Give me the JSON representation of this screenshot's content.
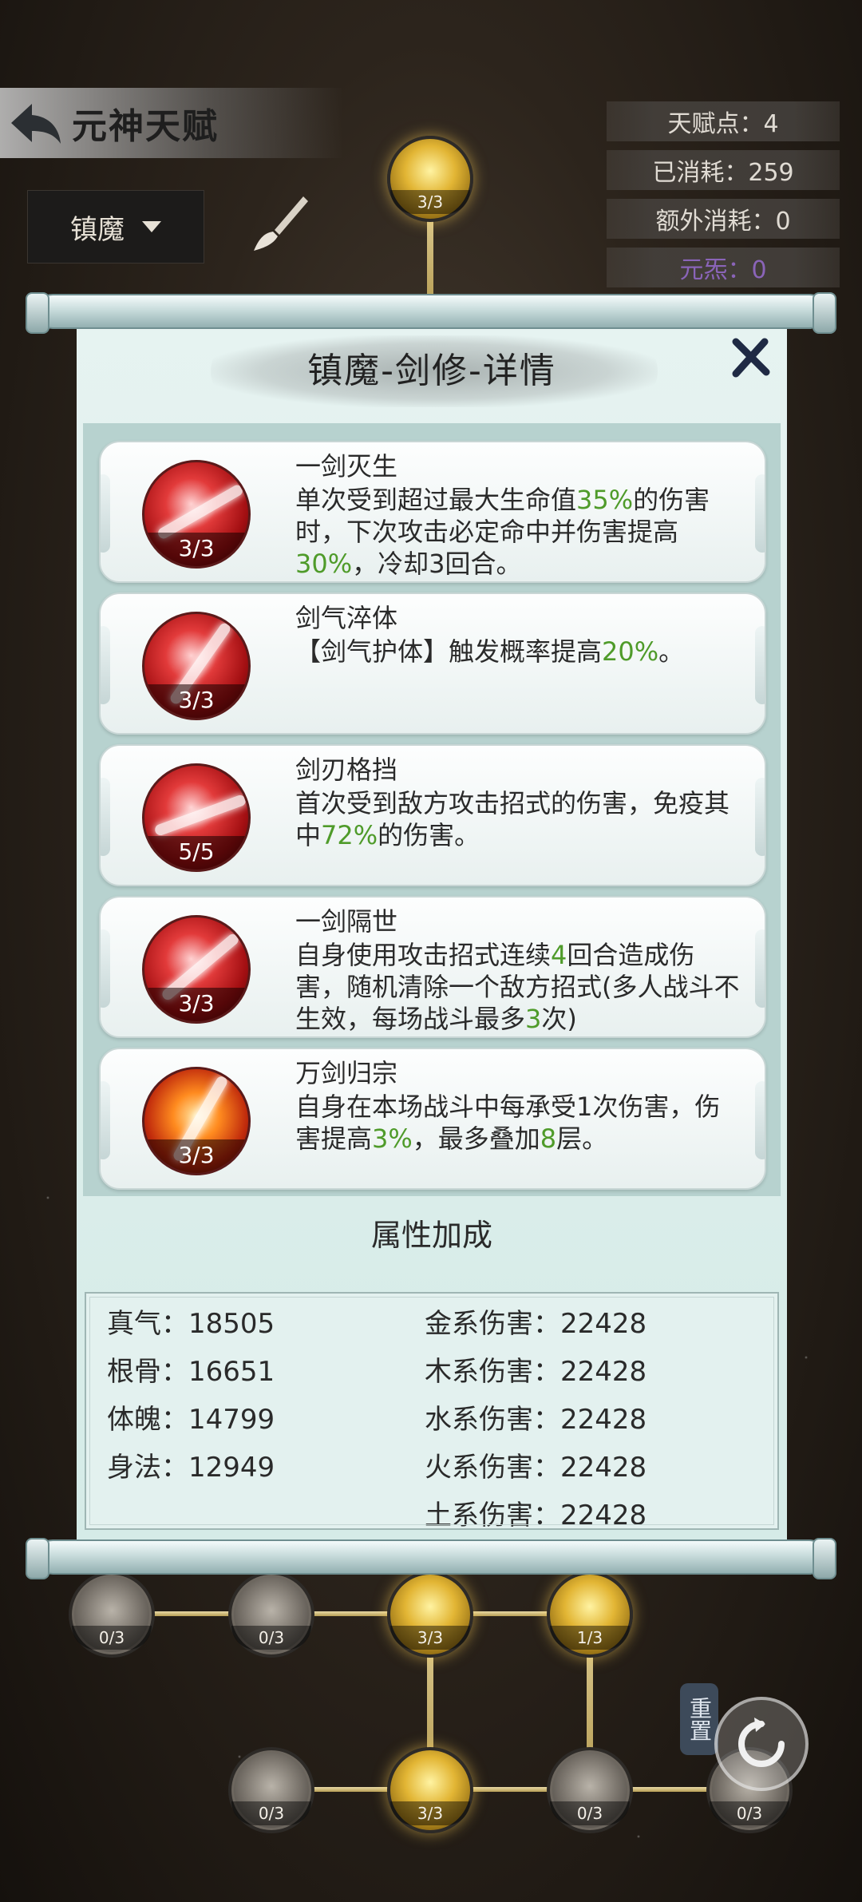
{
  "header": {
    "title": "元神天赋"
  },
  "dropdown": {
    "selected": "镇魔"
  },
  "stats": {
    "talent_points": "天赋点：4",
    "consumed": "已消耗：259",
    "extra_consumed": "额外消耗：0",
    "yuanxiao": "元炁：0"
  },
  "panel": {
    "title": "镇魔-剑修-详情",
    "skills": [
      {
        "name": "一剑灭生",
        "level": "3/3",
        "desc": [
          "单次受到超过最大生命值",
          "35%",
          "的伤害时，下次攻击必定命中并伤害提高",
          "30%",
          "，冷却3回合。"
        ]
      },
      {
        "name": "剑气淬体",
        "level": "3/3",
        "desc": [
          "【剑气护体】触发概率提高",
          "20%",
          "。"
        ]
      },
      {
        "name": "剑刃格挡",
        "level": "5/5",
        "desc": [
          "首次受到敌方攻击招式的伤害，免疫其中",
          "72%",
          "的伤害。"
        ]
      },
      {
        "name": "一剑隔世",
        "level": "3/3",
        "desc": [
          "自身使用攻击招式连续",
          "4",
          "回合造成伤害，随机清除一个敌方招式(多人战斗不生效，每场战斗最多",
          "3",
          "次)"
        ]
      },
      {
        "name": "万剑归宗",
        "level": "3/3",
        "desc": [
          "自身在本场战斗中每承受1次伤害，伤害提高",
          "3%",
          "，最多叠加",
          "8",
          "层。"
        ]
      }
    ],
    "attr_title": "属性加成",
    "attrs_left": [
      "真气：18505",
      "根骨：16651",
      "体魄：14799",
      "身法：12949"
    ],
    "attrs_right": [
      "金系伤害：22428",
      "木系伤害：22428",
      "水系伤害：22428",
      "火系伤害：22428",
      "土系伤害：22428"
    ]
  },
  "nodes": {
    "top": "3/3",
    "row1": [
      "0/3",
      "0/3",
      "3/3",
      "1/3"
    ],
    "row2": [
      "0/3",
      "3/3",
      "0/3",
      "0/3"
    ]
  },
  "reset_label": "重置",
  "colors": {
    "highlight_green": "#4f9b2a",
    "purple_text": "#8a64b8"
  }
}
